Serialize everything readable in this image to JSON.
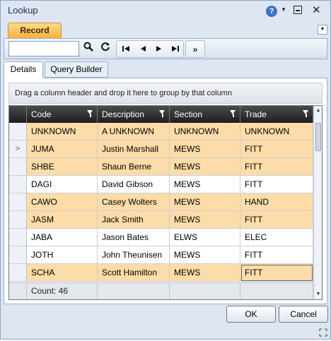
{
  "window": {
    "title": "Lookup"
  },
  "ribbon": {
    "tab_label": "Record",
    "search_value": ""
  },
  "tabs": [
    {
      "label": "Details"
    },
    {
      "label": "Query Builder"
    }
  ],
  "grid": {
    "group_hint": "Drag a column header and drop it here to group by that column",
    "columns": [
      "Code",
      "Description",
      "Section",
      "Trade"
    ],
    "rows": [
      {
        "code": "UNKNOWN",
        "description": "A UNKNOWN",
        "section": "UNKNOWN",
        "trade": "UNKNOWN"
      },
      {
        "code": "JUMA",
        "description": "Justin Marshall",
        "section": "MEWS",
        "trade": "FITT"
      },
      {
        "code": "SHBE",
        "description": "Shaun Berne",
        "section": "MEWS",
        "trade": "FITT"
      },
      {
        "code": "DAGI",
        "description": "David Gibson",
        "section": "MEWS",
        "trade": "FITT"
      },
      {
        "code": "CAWO",
        "description": "Casey Wolters",
        "section": "MEWS",
        "trade": "HAND"
      },
      {
        "code": "JASM",
        "description": "Jack Smith",
        "section": "MEWS",
        "trade": "FITT"
      },
      {
        "code": "JABA",
        "description": "Jason Bates",
        "section": "ELWS",
        "trade": "ELEC"
      },
      {
        "code": "JOTH",
        "description": "John Theunisen",
        "section": "MEWS",
        "trade": "FITT"
      },
      {
        "code": "SCHA",
        "description": "Scott Hamilton",
        "section": "MEWS",
        "trade": "FITT"
      }
    ],
    "current_row_marker": ">",
    "count_label": "Count: 46"
  },
  "buttons": {
    "ok": "OK",
    "cancel": "Cancel"
  },
  "colors": {
    "row_highlight": "#fcdca8",
    "header_bg": "#2e2e2e",
    "ribbon_tab": "#f7b23e"
  }
}
